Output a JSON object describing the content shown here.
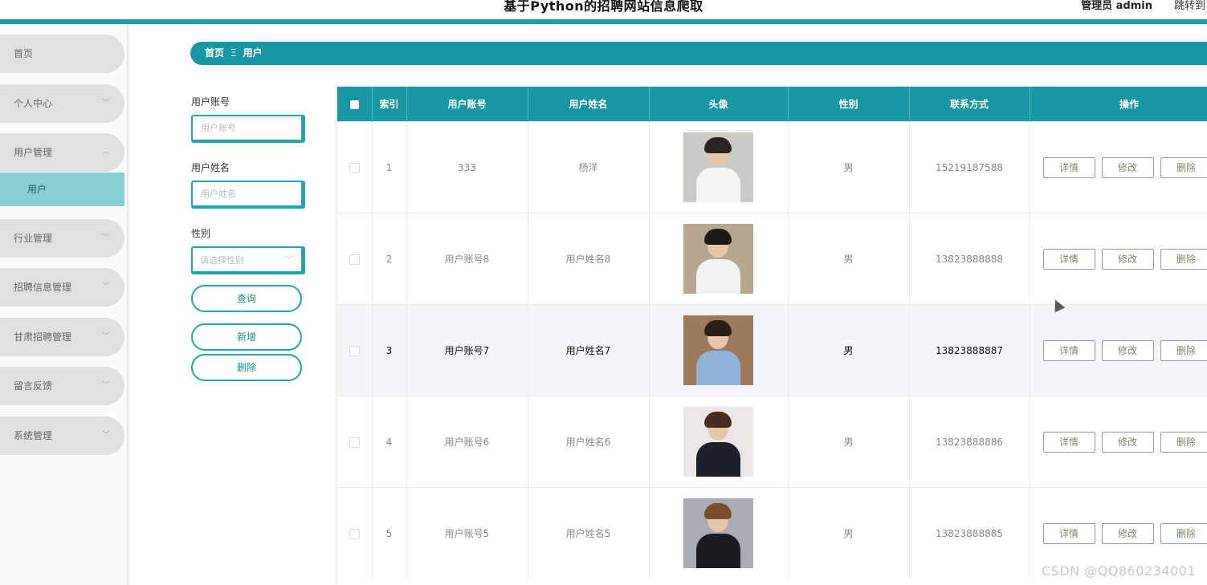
{
  "header": {
    "title": "基于Python的招聘网站信息爬取",
    "user": "管理员 admin",
    "jump": "跳转到"
  },
  "sidebar": {
    "items": [
      {
        "label": "首页",
        "chevron": ""
      },
      {
        "label": "个人中心",
        "chevron": "﹀"
      },
      {
        "label": "用户管理",
        "chevron": "︿"
      },
      {
        "label": "行业管理",
        "chevron": "﹀"
      },
      {
        "label": "招聘信息管理",
        "chevron": "﹀"
      },
      {
        "label": "甘肃招聘管理",
        "chevron": "﹀"
      },
      {
        "label": "留言反馈",
        "chevron": "﹀"
      },
      {
        "label": "系统管理",
        "chevron": "﹀"
      }
    ],
    "sub_item": "用户"
  },
  "breadcrumb": {
    "home": "首页",
    "separator": "Ξ",
    "current": "用户"
  },
  "search": {
    "account_label": "用户账号",
    "account_placeholder": "用户账号",
    "name_label": "用户姓名",
    "name_placeholder": "用户姓名",
    "gender_label": "性别",
    "gender_placeholder": "请选择性别",
    "query_btn": "查询",
    "add_btn": "新增",
    "delete_btn": "删除"
  },
  "table": {
    "columns": [
      "索引",
      "用户账号",
      "用户姓名",
      "头像",
      "性别",
      "联系方式",
      "操作"
    ],
    "rows": [
      {
        "index": "1",
        "account": "333",
        "name": "杨洋",
        "gender": "男",
        "phone": "15219187588"
      },
      {
        "index": "2",
        "account": "用户账号8",
        "name": "用户姓名8",
        "gender": "男",
        "phone": "13823888888"
      },
      {
        "index": "3",
        "account": "用户账号7",
        "name": "用户姓名7",
        "gender": "男",
        "phone": "13823888887"
      },
      {
        "index": "4",
        "account": "用户账号6",
        "name": "用户姓名6",
        "gender": "男",
        "phone": "13823888886"
      },
      {
        "index": "5",
        "account": "用户账号5",
        "name": "用户姓名5",
        "gender": "男",
        "phone": "13823888885"
      }
    ],
    "actions": {
      "detail": "详情",
      "edit": "修改",
      "delete": "删除"
    }
  },
  "colors": {
    "accent": "#1797a2",
    "sidebar_active": "#8acdd3",
    "row_highlight": "#f3f5f8"
  },
  "watermark": "CSDN @QQ860234001"
}
